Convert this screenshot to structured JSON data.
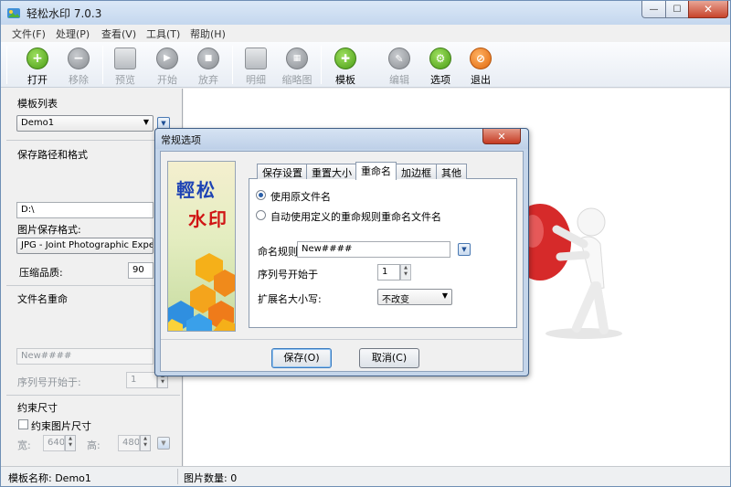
{
  "window": {
    "title": "轻松水印 7.0.3",
    "min_glyph": "—",
    "max_glyph": "☐",
    "close_glyph": "✕"
  },
  "menu": [
    "文件(F)",
    "处理(P)",
    "查看(V)",
    "工具(T)",
    "帮助(H)"
  ],
  "toolbar": {
    "open": "打开",
    "remove": "移除",
    "preview": "预览",
    "start": "开始",
    "abort": "放弃",
    "detail": "明细",
    "thumbnail": "缩略图",
    "template": "模板",
    "edit": "编辑",
    "options": "选项",
    "exit": "退出",
    "dropdown_glyph": "▼"
  },
  "left_panel": {
    "template_list_label": "模板列表",
    "template_selected": "Demo1",
    "save_path_label": "保存路径和格式",
    "save_path_value": "D:\\",
    "image_format_label": "图片保存格式:",
    "image_format_value": "JPG - Joint Photographic Experts",
    "quality_label": "压缩品质:",
    "quality_value": "90",
    "rename_label": "文件名重命",
    "rename_value": "New####",
    "seq_start_label": "序列号开始于:",
    "seq_start_value": "1",
    "constrain_label": "约束尺寸",
    "constrain_checkbox": "约束图片尺寸",
    "width_label": "宽:",
    "width_value": "640",
    "height_label": "高:",
    "height_value": "480"
  },
  "status": {
    "template_name": "模板名称: Demo1",
    "image_count": "图片数量: 0"
  },
  "dialog": {
    "title": "常规选项",
    "close_glyph": "✕",
    "banner_text1": "輕松",
    "banner_text2": "水印",
    "tabs": [
      "保存设置",
      "重置大小",
      "重命名",
      "加边框",
      "其他"
    ],
    "active_tab": "重命名",
    "radio_original": "使用原文件名",
    "radio_custom": "自动使用定义的重命规则重命名文件名",
    "rule_label": "命名规则",
    "rule_value": "New####",
    "seq_label": "序列号开始于",
    "seq_value": "1",
    "case_label": "扩展名大小写:",
    "case_value": "不改变",
    "save_button": "保存(O)",
    "cancel_button": "取消(C)"
  },
  "colors": {
    "accent": "#4a79b3",
    "close_red": "#c8442b",
    "banner_blue": "#1d43b4",
    "banner_red": "#d01515"
  }
}
